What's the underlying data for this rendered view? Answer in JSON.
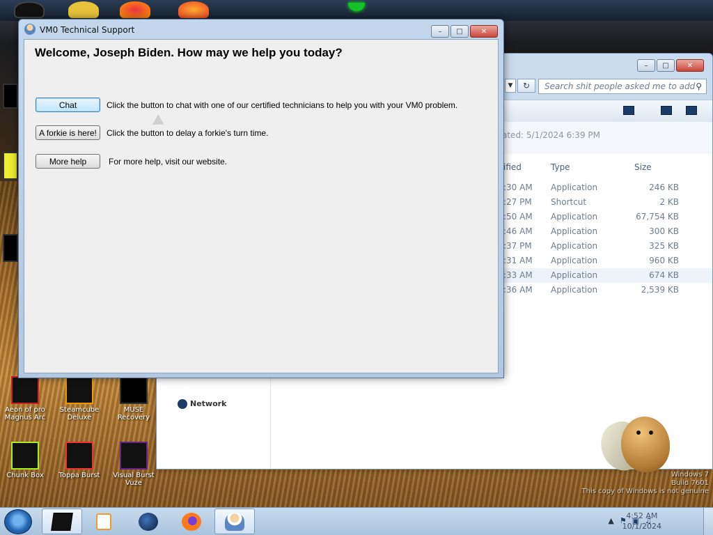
{
  "dialog": {
    "title": "VM0 Technical Support",
    "heading": "Welcome, Joseph Biden. How may we help you today?",
    "buttons": [
      {
        "label": "Chat",
        "description": "Click the button to chat with one of our certified technicians to help you with your VM0 problem."
      },
      {
        "label": "A forkie is here!",
        "description": "Click the button to delay a forkie's turn time."
      },
      {
        "label": "More help",
        "description": "For more help, visit our website."
      }
    ]
  },
  "explorer": {
    "search_placeholder": "Search shit people asked me to add",
    "details_text": "ated: 5/1/2024 6:39 PM",
    "columns": {
      "modified": "ified",
      "type": "Type",
      "size": "Size"
    },
    "rows": [
      {
        "modified": ":30 AM",
        "type": "Application",
        "size": "246 KB"
      },
      {
        "modified": ":27 PM",
        "type": "Shortcut",
        "size": "2 KB"
      },
      {
        "modified": ":50 AM",
        "type": "Application",
        "size": "67,754 KB"
      },
      {
        "modified": ":46 AM",
        "type": "Application",
        "size": "300 KB"
      },
      {
        "modified": ":37 PM",
        "type": "Application",
        "size": "325 KB"
      },
      {
        "modified": ":31 AM",
        "type": "Application",
        "size": "960 KB"
      },
      {
        "modified": ":33 AM",
        "type": "Application",
        "size": "674 KB"
      },
      {
        "modified": ":36 AM",
        "type": "Application",
        "size": "2,539 KB"
      }
    ],
    "nav_network": "Network"
  },
  "desktop": {
    "icons_row1": [
      "Aeon of pro Magnus Arc",
      "Steamcube Deluxe",
      "MUSE Recovery"
    ],
    "icons_row2": [
      "Chunk Box",
      "Toppa Burst",
      "Visual Burst Vuze"
    ],
    "watermark": [
      "Windows 7",
      "Build 7601",
      "This copy of Windows is not genuine"
    ]
  },
  "taskbar": {
    "clock_time": "4:52 AM",
    "clock_date": "10/1/2024"
  },
  "colors": {
    "titlebar": "#c2d6ec",
    "client_bg": "#efefef",
    "taskbar": "#b9d0e8"
  }
}
